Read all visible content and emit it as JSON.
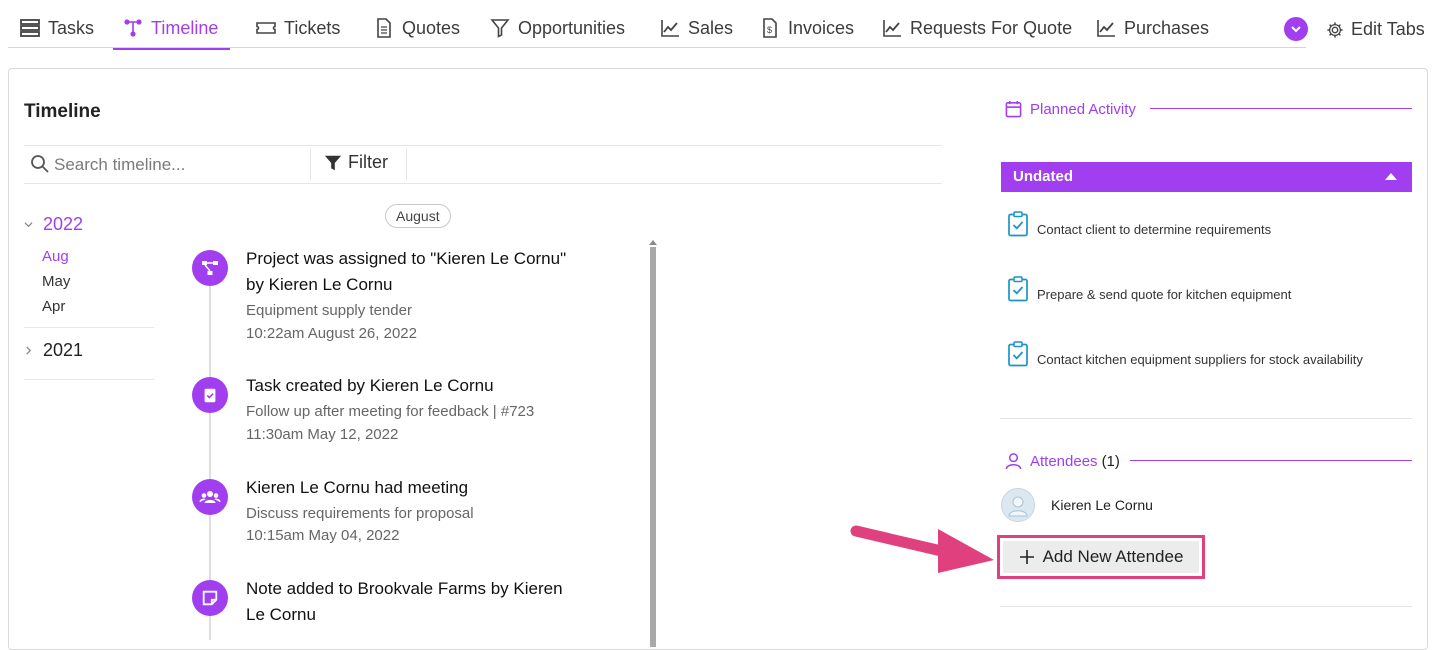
{
  "tabs": [
    {
      "label": "Tasks",
      "icon": "tasks-icon"
    },
    {
      "label": "Timeline",
      "icon": "timeline-icon",
      "active": true
    },
    {
      "label": "Tickets",
      "icon": "ticket-icon"
    },
    {
      "label": "Quotes",
      "icon": "document-icon"
    },
    {
      "label": "Opportunities",
      "icon": "funnel-icon"
    },
    {
      "label": "Sales",
      "icon": "trend-icon"
    },
    {
      "label": "Invoices",
      "icon": "invoice-icon"
    },
    {
      "label": "Requests For Quote",
      "icon": "trend-icon"
    },
    {
      "label": "Purchases",
      "icon": "trend-icon"
    }
  ],
  "edit_tabs_label": "Edit Tabs",
  "timeline": {
    "title": "Timeline",
    "search_placeholder": "Search timeline...",
    "filter_label": "Filter",
    "years": [
      {
        "year": "2022",
        "expanded": true,
        "months": [
          "Aug",
          "May",
          "Apr"
        ],
        "active_month": "Aug"
      },
      {
        "year": "2021",
        "expanded": false
      }
    ],
    "month_badge": "August",
    "events": [
      {
        "icon": "project-icon",
        "title": "Project was assigned to \"Kieren Le Cornu\" by Kieren Le Cornu",
        "subtitle": "Equipment supply tender",
        "time": "10:22am August 26, 2022"
      },
      {
        "icon": "task-icon",
        "title": "Task created by Kieren Le Cornu",
        "subtitle": "Follow up after meeting for feedback | #723",
        "time": "11:30am May 12, 2022"
      },
      {
        "icon": "meeting-icon",
        "title": "Kieren Le Cornu had meeting",
        "subtitle": "Discuss requirements for proposal",
        "time": "10:15am May 04, 2022"
      },
      {
        "icon": "note-icon",
        "title": "Note added to Brookvale Farms by Kieren Le Cornu",
        "subtitle": "",
        "time": ""
      }
    ]
  },
  "planned": {
    "heading": "Planned Activity",
    "group_label": "Undated",
    "items": [
      "Contact client to determine requirements",
      "Prepare & send quote for kitchen equipment",
      "Contact kitchen equipment suppliers for stock availability"
    ]
  },
  "attendees": {
    "heading": "Attendees",
    "count": "(1)",
    "list": [
      "Kieren Le Cornu"
    ],
    "add_label": "Add New Attendee"
  },
  "colors": {
    "accent": "#a03ef0",
    "highlight": "#e0407d",
    "icon_blue": "#1a94c9"
  }
}
